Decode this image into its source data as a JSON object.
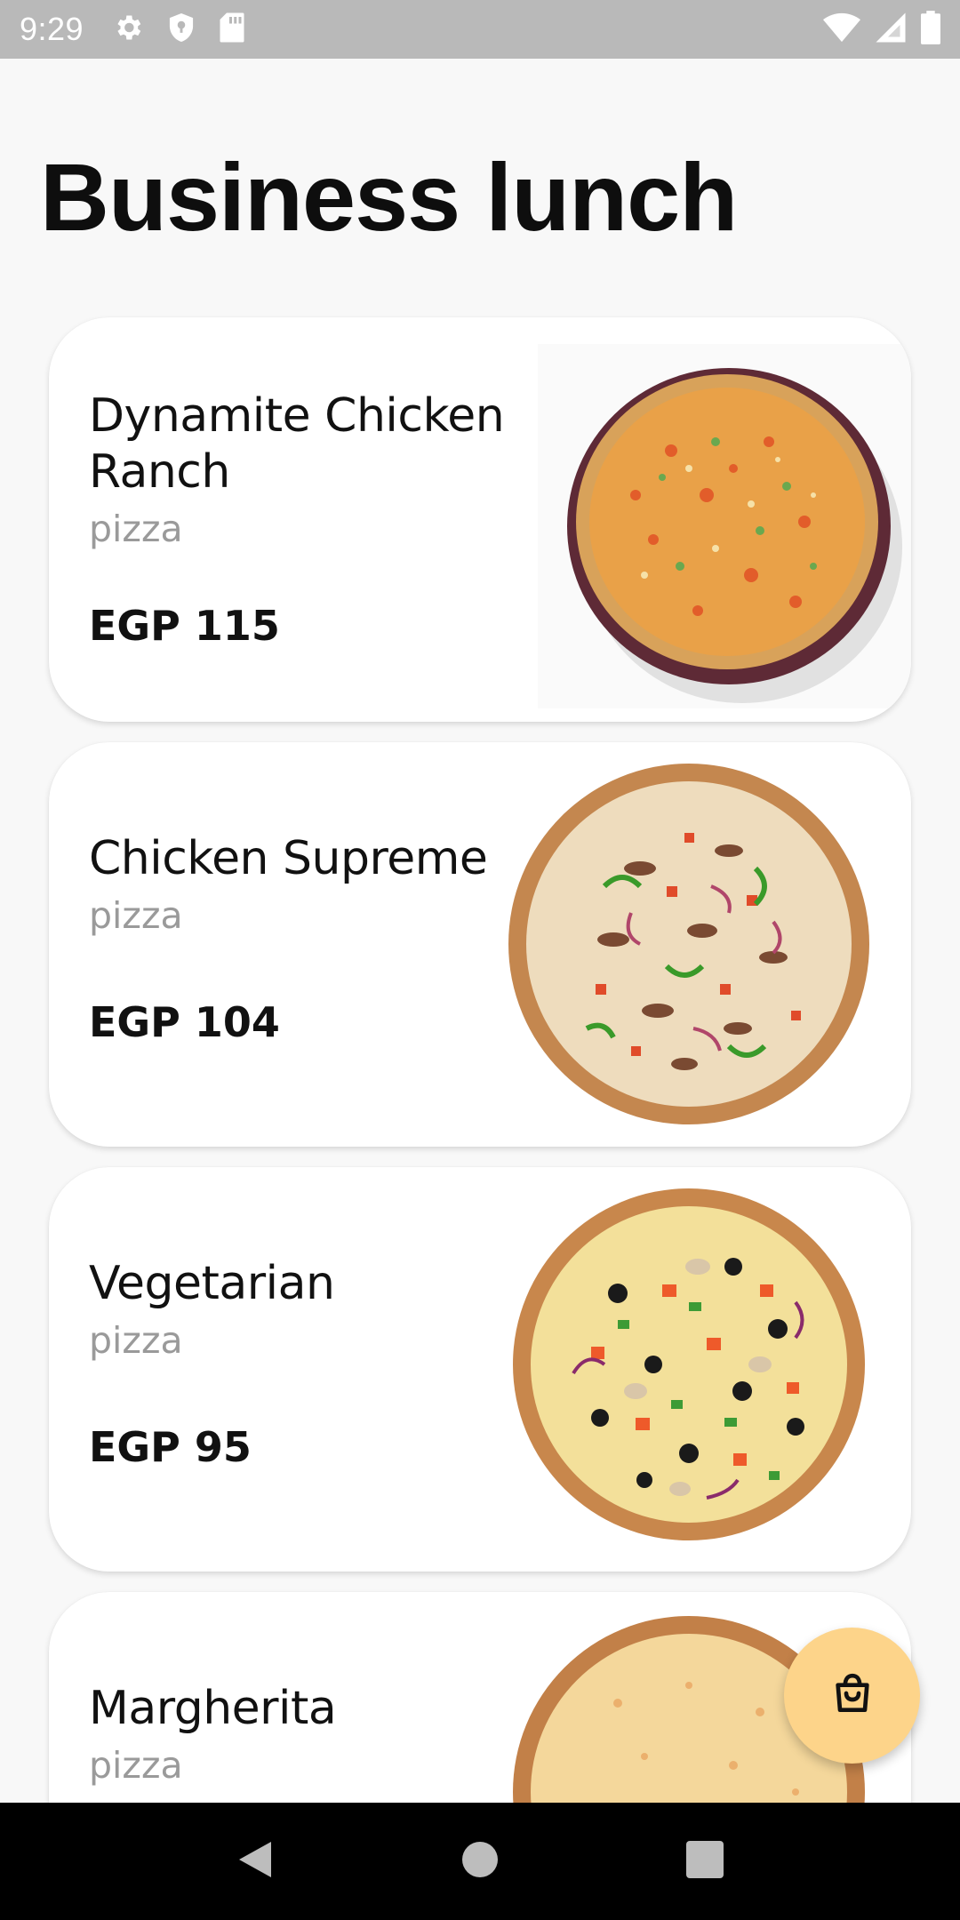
{
  "status_bar": {
    "time": "9:29",
    "left_icons": [
      "settings-icon",
      "shield-icon",
      "sd-card-icon"
    ],
    "right_icons": [
      "wifi-icon",
      "cell-signal-icon",
      "battery-icon"
    ]
  },
  "page": {
    "title": "Business lunch"
  },
  "products": [
    {
      "name": "Dynamite Chicken Ranch",
      "category": "pizza",
      "price": "EGP 115",
      "image": "pizza-dynamite-chicken-ranch"
    },
    {
      "name": "Chicken Supreme",
      "category": "pizza",
      "price": "EGP 104",
      "image": "pizza-chicken-supreme"
    },
    {
      "name": "Vegetarian",
      "category": "pizza",
      "price": "EGP 95",
      "image": "pizza-vegetarian"
    },
    {
      "name": "Margherita",
      "category": "pizza",
      "image": "pizza-margherita"
    }
  ],
  "cart_button": {
    "icon": "shopping-bag-icon"
  },
  "nav_bar": {
    "icons": [
      "back-icon",
      "home-icon",
      "recents-icon"
    ]
  },
  "colors": {
    "background": "#f8f8f8",
    "status_bar": "#b9b9b9",
    "card": "#ffffff",
    "category_text": "#9a9a9a",
    "cart_button": "#fdd48a",
    "nav_bar": "#000000"
  }
}
